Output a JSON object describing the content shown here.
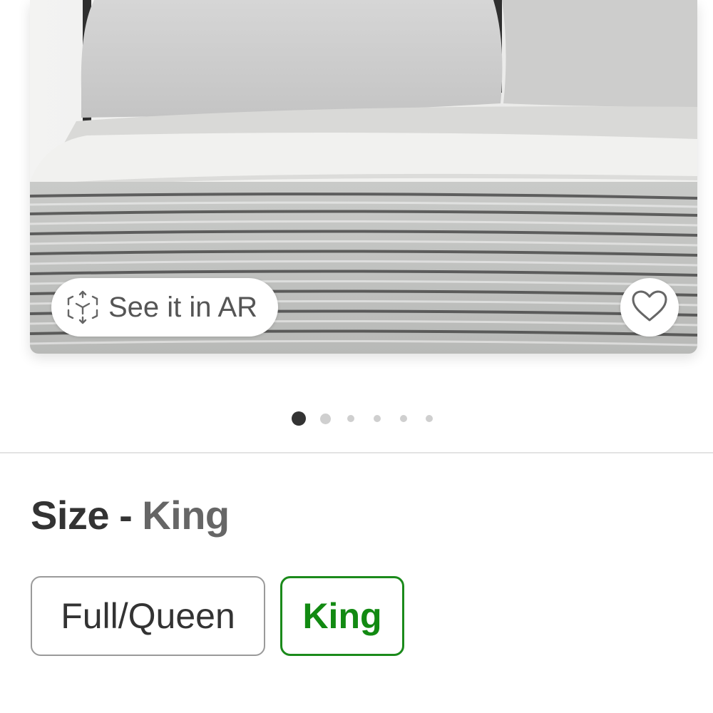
{
  "gallery": {
    "ar_label": "See it in AR",
    "ar_icon": "ar-cube-icon",
    "favorite_icon": "heart-outline-icon",
    "image_count": 6,
    "active_index": 0
  },
  "size": {
    "label": "Size",
    "separator": "-",
    "selected": "King",
    "options": [
      "Full/Queen",
      "King"
    ]
  },
  "colors": {
    "selected_accent": "#128a12",
    "active_dot": "#333333",
    "inactive_dot": "#cfcfcf"
  }
}
